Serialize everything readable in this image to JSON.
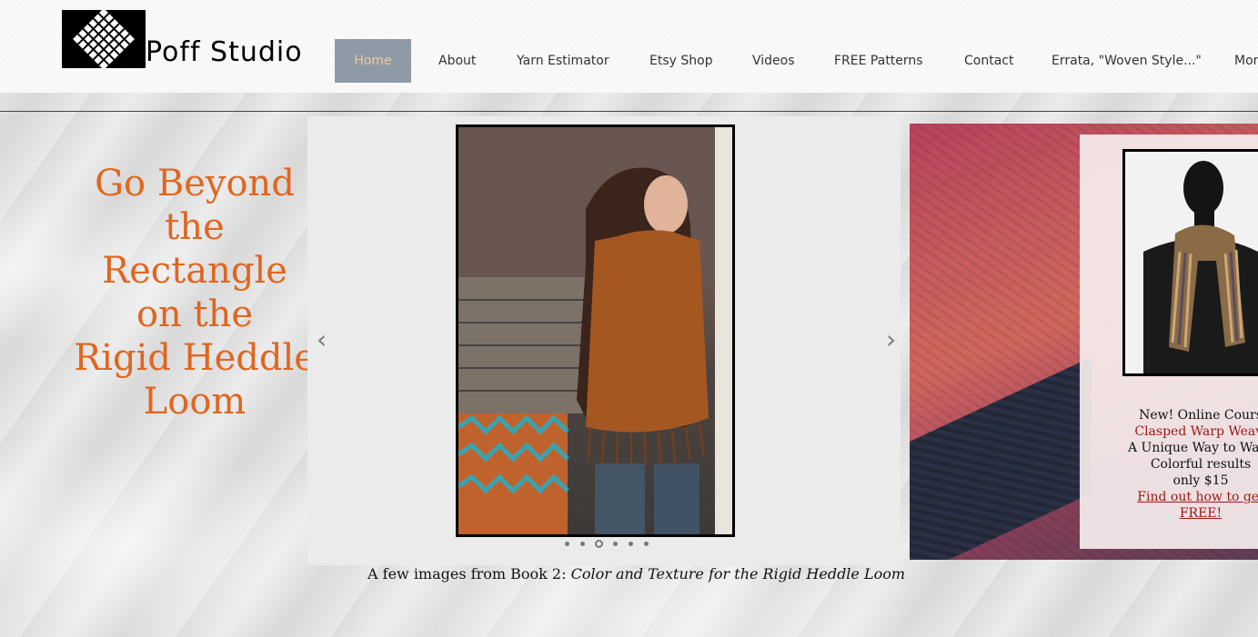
{
  "header": {
    "logo_text": "Poff Studio",
    "nav": [
      {
        "label": "Home",
        "active": true
      },
      {
        "label": "About",
        "active": false
      },
      {
        "label": "Yarn Estimator",
        "active": false
      },
      {
        "label": "Etsy Shop",
        "active": false
      },
      {
        "label": "Videos",
        "active": false
      },
      {
        "label": "FREE Patterns",
        "active": false
      },
      {
        "label": "Contact",
        "active": false
      },
      {
        "label": "Errata, \"Woven Style...\"",
        "active": false
      },
      {
        "label": "Mor",
        "active": false
      }
    ]
  },
  "hero": {
    "lines": [
      "Go Beyond",
      "the",
      "Rectangle",
      "on the",
      "Rigid Heddle",
      "Loom"
    ],
    "color": "#e0661f"
  },
  "slideshow": {
    "prev_icon": "chevron-left-icon",
    "next_icon": "chevron-right-icon",
    "prev_glyph": "‹",
    "next_glyph": "›",
    "dot_count": 6,
    "active_dot": 2,
    "caption_prefix": "A few images from Book 2: ",
    "caption_title": "Color and Texture for the Rigid Heddle Loom"
  },
  "promo": {
    "line1": "New! Online Cours",
    "line2": "Clasped Warp Weavi",
    "line3": "A Unique Way to Warp",
    "line4": "Colorful results",
    "line5": "only $15",
    "link_line1": "Find out how to get",
    "link_line2": "FREE!"
  },
  "colors": {
    "nav_active_bg": "#8e9ba6",
    "nav_active_text": "#f3c79c",
    "promo_red": "#a31616"
  }
}
